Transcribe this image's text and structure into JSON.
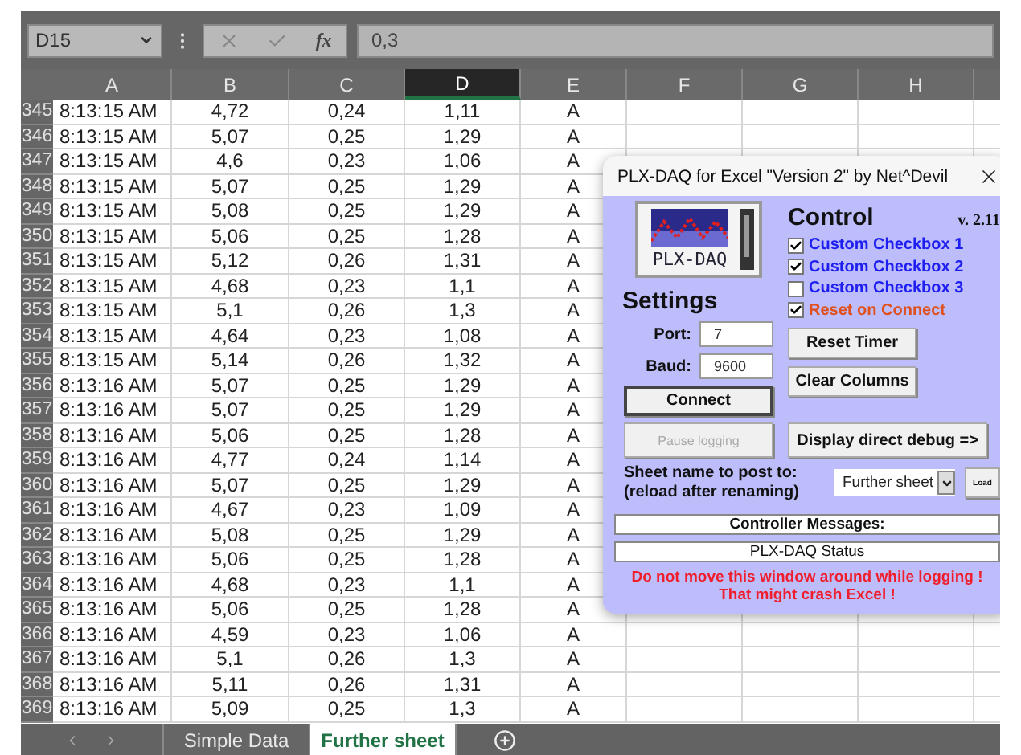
{
  "name_box": "D15",
  "formula_bar": {
    "fx": "fx",
    "value": "0,3"
  },
  "columns": [
    {
      "label": "A",
      "selected": false
    },
    {
      "label": "B",
      "selected": false
    },
    {
      "label": "C",
      "selected": false
    },
    {
      "label": "D",
      "selected": true
    },
    {
      "label": "E",
      "selected": false
    },
    {
      "label": "F",
      "selected": false
    },
    {
      "label": "G",
      "selected": false
    },
    {
      "label": "H",
      "selected": false
    }
  ],
  "rows": [
    {
      "number": "345",
      "cells": [
        "8:13:15 AM",
        "4,72",
        "0,24",
        "1,11",
        "A"
      ]
    },
    {
      "number": "346",
      "cells": [
        "8:13:15 AM",
        "5,07",
        "0,25",
        "1,29",
        "A"
      ]
    },
    {
      "number": "347",
      "cells": [
        "8:13:15 AM",
        "4,6",
        "0,23",
        "1,06",
        "A"
      ]
    },
    {
      "number": "348",
      "cells": [
        "8:13:15 AM",
        "5,07",
        "0,25",
        "1,29",
        "A"
      ]
    },
    {
      "number": "349",
      "cells": [
        "8:13:15 AM",
        "5,08",
        "0,25",
        "1,29",
        "A"
      ]
    },
    {
      "number": "350",
      "cells": [
        "8:13:15 AM",
        "5,06",
        "0,25",
        "1,28",
        "A"
      ]
    },
    {
      "number": "351",
      "cells": [
        "8:13:15 AM",
        "5,12",
        "0,26",
        "1,31",
        "A"
      ]
    },
    {
      "number": "352",
      "cells": [
        "8:13:15 AM",
        "4,68",
        "0,23",
        "1,1",
        "A"
      ]
    },
    {
      "number": "353",
      "cells": [
        "8:13:15 AM",
        "5,1",
        "0,26",
        "1,3",
        "A"
      ]
    },
    {
      "number": "354",
      "cells": [
        "8:13:15 AM",
        "4,64",
        "0,23",
        "1,08",
        "A"
      ]
    },
    {
      "number": "355",
      "cells": [
        "8:13:15 AM",
        "5,14",
        "0,26",
        "1,32",
        "A"
      ]
    },
    {
      "number": "356",
      "cells": [
        "8:13:16 AM",
        "5,07",
        "0,25",
        "1,29",
        "A"
      ]
    },
    {
      "number": "357",
      "cells": [
        "8:13:16 AM",
        "5,07",
        "0,25",
        "1,29",
        "A"
      ]
    },
    {
      "number": "358",
      "cells": [
        "8:13:16 AM",
        "5,06",
        "0,25",
        "1,28",
        "A"
      ]
    },
    {
      "number": "359",
      "cells": [
        "8:13:16 AM",
        "4,77",
        "0,24",
        "1,14",
        "A"
      ]
    },
    {
      "number": "360",
      "cells": [
        "8:13:16 AM",
        "5,07",
        "0,25",
        "1,29",
        "A"
      ]
    },
    {
      "number": "361",
      "cells": [
        "8:13:16 AM",
        "4,67",
        "0,23",
        "1,09",
        "A"
      ]
    },
    {
      "number": "362",
      "cells": [
        "8:13:16 AM",
        "5,08",
        "0,25",
        "1,29",
        "A"
      ]
    },
    {
      "number": "363",
      "cells": [
        "8:13:16 AM",
        "5,06",
        "0,25",
        "1,28",
        "A"
      ]
    },
    {
      "number": "364",
      "cells": [
        "8:13:16 AM",
        "4,68",
        "0,23",
        "1,1",
        "A"
      ]
    },
    {
      "number": "365",
      "cells": [
        "8:13:16 AM",
        "5,06",
        "0,25",
        "1,28",
        "A"
      ]
    },
    {
      "number": "366",
      "cells": [
        "8:13:16 AM",
        "4,59",
        "0,23",
        "1,06",
        "A"
      ]
    },
    {
      "number": "367",
      "cells": [
        "8:13:16 AM",
        "5,1",
        "0,26",
        "1,3",
        "A"
      ]
    },
    {
      "number": "368",
      "cells": [
        "8:13:16 AM",
        "5,11",
        "0,26",
        "1,31",
        "A"
      ]
    },
    {
      "number": "369",
      "cells": [
        "8:13:16 AM",
        "5,09",
        "0,25",
        "1,3",
        "A"
      ]
    }
  ],
  "sheet_tabs": [
    {
      "label": "Simple Data",
      "selected": false
    },
    {
      "label": "Further sheet",
      "selected": true
    }
  ],
  "dialog": {
    "title": "PLX-DAQ for Excel \"Version 2\" by Net^Devil",
    "logo_text": "PLX-DAQ",
    "settings": {
      "heading": "Settings",
      "port_label": "Port:",
      "port": "7",
      "baud_label": "Baud:",
      "baud": "9600"
    },
    "control": {
      "heading": "Control",
      "version": "v. 2.11",
      "checkboxes": [
        {
          "label": "Custom Checkbox 1",
          "checked": true,
          "color": "#1e1ef0"
        },
        {
          "label": "Custom Checkbox 2",
          "checked": true,
          "color": "#1e1ef0"
        },
        {
          "label": "Custom Checkbox 3",
          "checked": false,
          "color": "#1e1ef0"
        },
        {
          "label": "Reset on Connect",
          "checked": true,
          "color": "#e0501c"
        }
      ]
    },
    "connect_button": {
      "label": "Connect",
      "disabled": false
    },
    "reset_timer_button": {
      "label": "Reset Timer",
      "disabled": false
    },
    "clear_columns_button": {
      "label": "Clear Columns",
      "disabled": false
    },
    "pause_button": {
      "label": "Pause logging",
      "disabled": true
    },
    "debug_button": {
      "label": "Display direct debug =>",
      "disabled": false
    },
    "sheet_label": [
      "Sheet name to post to:",
      "(reload after renaming)"
    ],
    "sheet_select": "Further sheet",
    "load_button": {
      "label": "Load",
      "disabled": false
    },
    "messages_heading": "Controller Messages:",
    "status": "PLX-DAQ Status",
    "warning": [
      "Do not move this window around while logging !",
      "That might crash Excel !"
    ]
  }
}
